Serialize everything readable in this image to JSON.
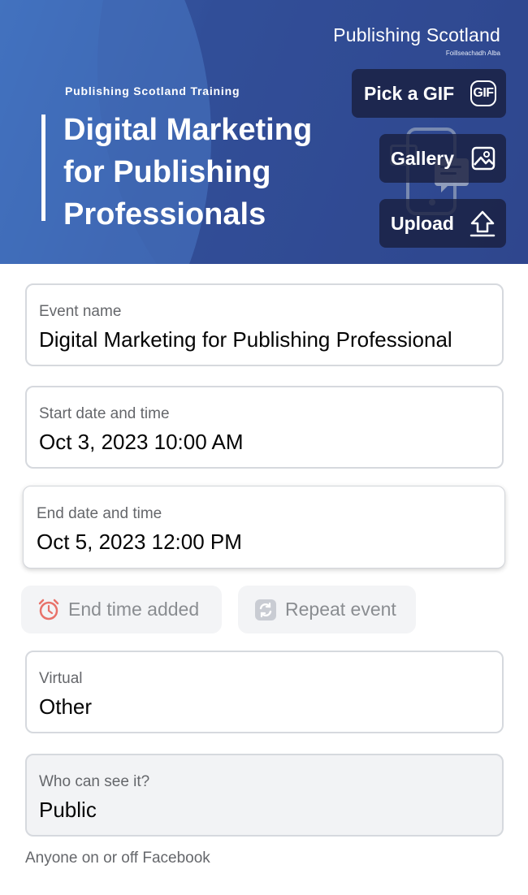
{
  "banner": {
    "logo_main": "Publishing Scotland",
    "logo_sub": "Foillseachadh Alba",
    "kicker": "Publishing Scotland Training",
    "title_line1": "Digital Marketing",
    "title_line2": "for Publishing",
    "title_line3": "Professionals",
    "bg_color": "#34549f"
  },
  "media_buttons": {
    "gif_label": "Pick a GIF",
    "gif_icon_text": "GIF",
    "gallery_label": "Gallery",
    "upload_label": "Upload"
  },
  "form": {
    "event_name": {
      "label": "Event name",
      "value": "Digital Marketing for Publishing Professional"
    },
    "start": {
      "label": "Start date and time",
      "value": "Oct 3, 2023 10:00 AM"
    },
    "end": {
      "label": "End date and time",
      "value": "Oct 5, 2023 12:00 PM"
    },
    "chips": {
      "end_time": {
        "label": "End time added",
        "icon": "alarm-clock-icon"
      },
      "repeat": {
        "label": "Repeat event",
        "icon": "repeat-icon"
      }
    },
    "virtual": {
      "label": "Virtual",
      "value": "Other"
    },
    "visibility": {
      "label": "Who can see it?",
      "value": "Public",
      "helper": "Anyone on or off Facebook"
    }
  }
}
